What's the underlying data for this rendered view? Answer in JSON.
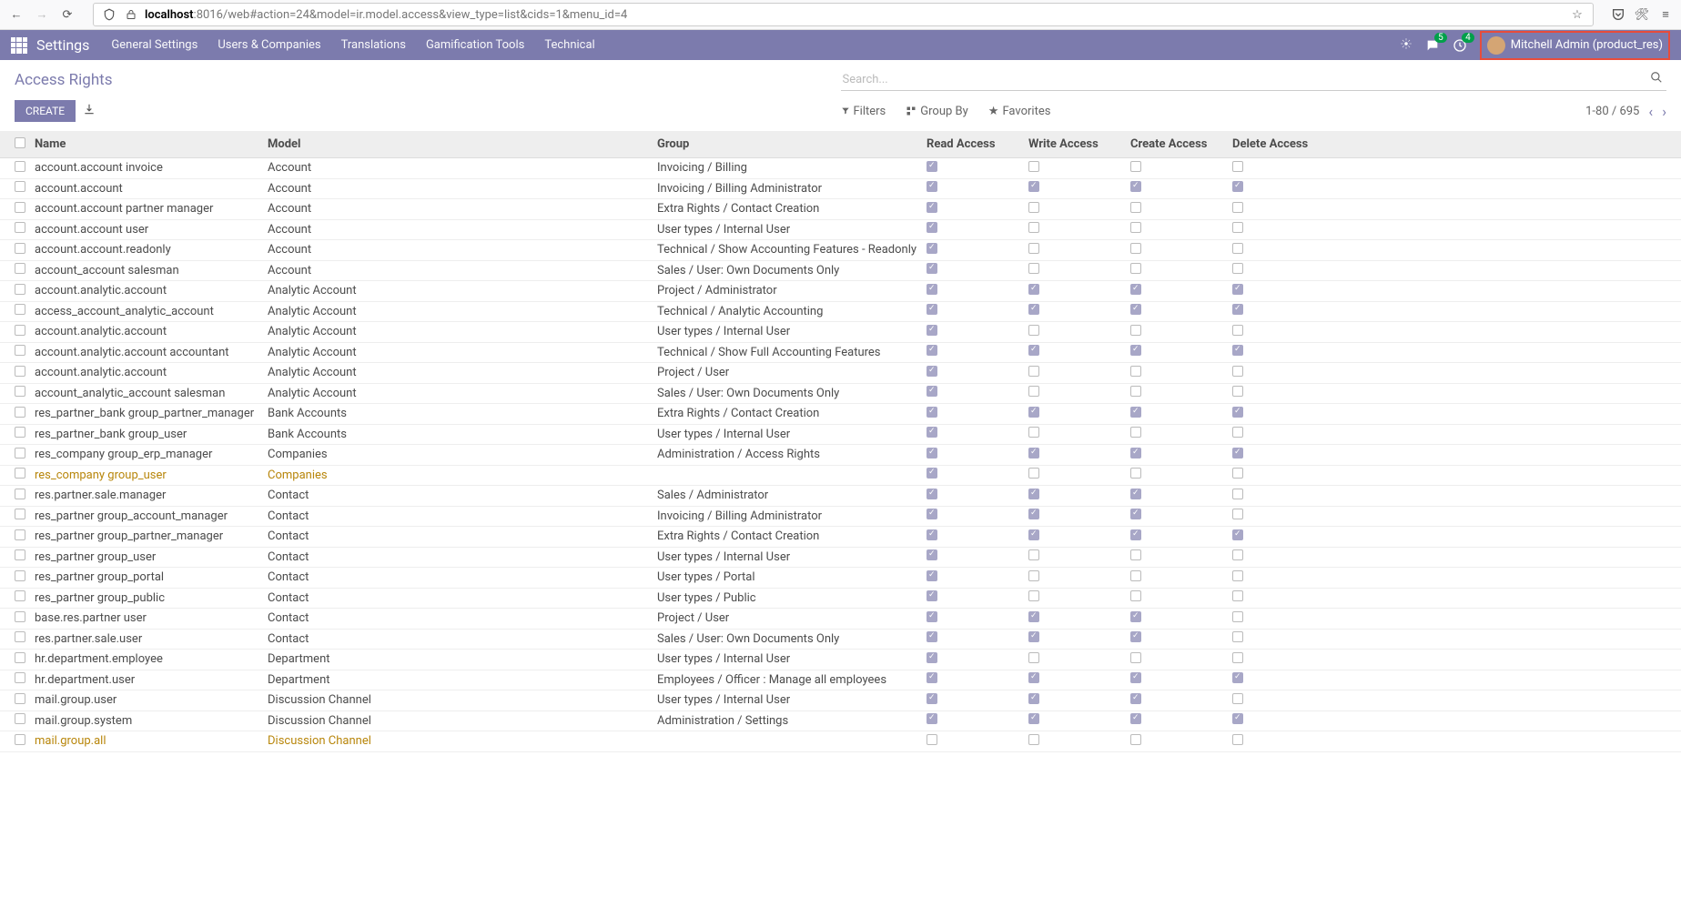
{
  "browser": {
    "url_prefix": "localhost",
    "url_rest": ":8016/web#action=24&model=ir.model.access&view_type=list&cids=1&menu_id=4"
  },
  "topnav": {
    "title": "Settings",
    "menu": [
      "General Settings",
      "Users & Companies",
      "Translations",
      "Gamification Tools",
      "Technical"
    ],
    "messages_badge": "5",
    "activities_badge": "4",
    "user": "Mitchell Admin (product_res)"
  },
  "cp": {
    "breadcrumb": "Access Rights",
    "search_placeholder": "Search...",
    "create": "CREATE",
    "filters": "Filters",
    "groupby": "Group By",
    "favorites": "Favorites",
    "pager": "1-80 / 695"
  },
  "columns": {
    "name": "Name",
    "model": "Model",
    "group": "Group",
    "read": "Read Access",
    "write": "Write Access",
    "create": "Create Access",
    "delete": "Delete Access"
  },
  "rows": [
    {
      "name": "account.account invoice",
      "model": "Account",
      "group": "Invoicing / Billing",
      "r": true,
      "w": false,
      "c": false,
      "d": false
    },
    {
      "name": "account.account",
      "model": "Account",
      "group": "Invoicing / Billing Administrator",
      "r": true,
      "w": true,
      "c": true,
      "d": true
    },
    {
      "name": "account.account partner manager",
      "model": "Account",
      "group": "Extra Rights / Contact Creation",
      "r": true,
      "w": false,
      "c": false,
      "d": false
    },
    {
      "name": "account.account user",
      "model": "Account",
      "group": "User types / Internal User",
      "r": true,
      "w": false,
      "c": false,
      "d": false
    },
    {
      "name": "account.account.readonly",
      "model": "Account",
      "group": "Technical / Show Accounting Features - Readonly",
      "r": true,
      "w": false,
      "c": false,
      "d": false
    },
    {
      "name": "account_account salesman",
      "model": "Account",
      "group": "Sales / User: Own Documents Only",
      "r": true,
      "w": false,
      "c": false,
      "d": false
    },
    {
      "name": "account.analytic.account",
      "model": "Analytic Account",
      "group": "Project / Administrator",
      "r": true,
      "w": true,
      "c": true,
      "d": true
    },
    {
      "name": "access_account_analytic_account",
      "model": "Analytic Account",
      "group": "Technical / Analytic Accounting",
      "r": true,
      "w": true,
      "c": true,
      "d": true
    },
    {
      "name": "account.analytic.account",
      "model": "Analytic Account",
      "group": "User types / Internal User",
      "r": true,
      "w": false,
      "c": false,
      "d": false
    },
    {
      "name": "account.analytic.account accountant",
      "model": "Analytic Account",
      "group": "Technical / Show Full Accounting Features",
      "r": true,
      "w": true,
      "c": true,
      "d": true
    },
    {
      "name": "account.analytic.account",
      "model": "Analytic Account",
      "group": "Project / User",
      "r": true,
      "w": false,
      "c": false,
      "d": false
    },
    {
      "name": "account_analytic_account salesman",
      "model": "Analytic Account",
      "group": "Sales / User: Own Documents Only",
      "r": true,
      "w": false,
      "c": false,
      "d": false
    },
    {
      "name": "res_partner_bank group_partner_manager",
      "model": "Bank Accounts",
      "group": "Extra Rights / Contact Creation",
      "r": true,
      "w": true,
      "c": true,
      "d": true
    },
    {
      "name": "res_partner_bank group_user",
      "model": "Bank Accounts",
      "group": "User types / Internal User",
      "r": true,
      "w": false,
      "c": false,
      "d": false
    },
    {
      "name": "res_company group_erp_manager",
      "model": "Companies",
      "group": "Administration / Access Rights",
      "r": true,
      "w": true,
      "c": true,
      "d": true
    },
    {
      "name": "res_company group_user",
      "model": "Companies",
      "group": "",
      "r": true,
      "w": false,
      "c": false,
      "d": false,
      "warn": true
    },
    {
      "name": "res.partner.sale.manager",
      "model": "Contact",
      "group": "Sales / Administrator",
      "r": true,
      "w": true,
      "c": true,
      "d": false
    },
    {
      "name": "res_partner group_account_manager",
      "model": "Contact",
      "group": "Invoicing / Billing Administrator",
      "r": true,
      "w": true,
      "c": true,
      "d": false
    },
    {
      "name": "res_partner group_partner_manager",
      "model": "Contact",
      "group": "Extra Rights / Contact Creation",
      "r": true,
      "w": true,
      "c": true,
      "d": true
    },
    {
      "name": "res_partner group_user",
      "model": "Contact",
      "group": "User types / Internal User",
      "r": true,
      "w": false,
      "c": false,
      "d": false
    },
    {
      "name": "res_partner group_portal",
      "model": "Contact",
      "group": "User types / Portal",
      "r": true,
      "w": false,
      "c": false,
      "d": false
    },
    {
      "name": "res_partner group_public",
      "model": "Contact",
      "group": "User types / Public",
      "r": true,
      "w": false,
      "c": false,
      "d": false
    },
    {
      "name": "base.res.partner user",
      "model": "Contact",
      "group": "Project / User",
      "r": true,
      "w": true,
      "c": true,
      "d": false
    },
    {
      "name": "res.partner.sale.user",
      "model": "Contact",
      "group": "Sales / User: Own Documents Only",
      "r": true,
      "w": true,
      "c": true,
      "d": false
    },
    {
      "name": "hr.department.employee",
      "model": "Department",
      "group": "User types / Internal User",
      "r": true,
      "w": false,
      "c": false,
      "d": false
    },
    {
      "name": "hr.department.user",
      "model": "Department",
      "group": "Employees / Officer : Manage all employees",
      "r": true,
      "w": true,
      "c": true,
      "d": true
    },
    {
      "name": "mail.group.user",
      "model": "Discussion Channel",
      "group": "User types / Internal User",
      "r": true,
      "w": true,
      "c": true,
      "d": false
    },
    {
      "name": "mail.group.system",
      "model": "Discussion Channel",
      "group": "Administration / Settings",
      "r": true,
      "w": true,
      "c": true,
      "d": true
    },
    {
      "name": "mail.group.all",
      "model": "Discussion Channel",
      "group": "",
      "r": false,
      "w": false,
      "c": false,
      "d": false,
      "warn": true
    }
  ]
}
